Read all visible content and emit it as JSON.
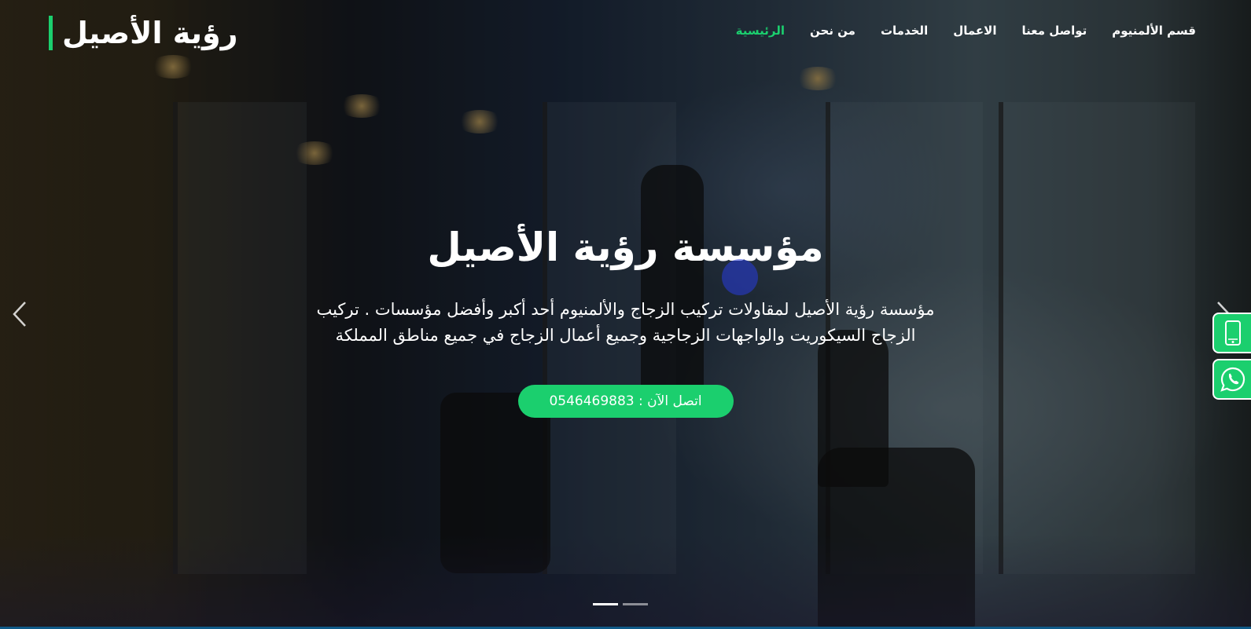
{
  "header": {
    "logo_text": "رؤية الأصيل",
    "nav": [
      {
        "label": "الرئيسية",
        "active": true
      },
      {
        "label": "من نحن",
        "active": false
      },
      {
        "label": "الخدمات",
        "active": false
      },
      {
        "label": "الاعمال",
        "active": false
      },
      {
        "label": "تواصل معنا",
        "active": false
      },
      {
        "label": "قسم الألمنيوم",
        "active": false
      }
    ]
  },
  "hero": {
    "headline": "مؤسسة رؤية الأصيل",
    "subtext": "مؤسسة رؤية الأصيل لمقاولات تركيب الزجاج والألمنيوم أحد أكبر وأفضل مؤسسات . تركيب الزجاج السيكوريت والواجهات الزجاجية وجميع أعمال الزجاج في جميع مناطق المملكة",
    "cta_label": "اتصل الآن : 0546469883"
  },
  "carousel": {
    "prev_icon": "chevron-left-icon",
    "next_icon": "chevron-right-icon",
    "slides": 2,
    "active_slide": 1
  },
  "floating": {
    "phone_icon": "mobile-phone-icon",
    "whatsapp_icon": "whatsapp-icon"
  },
  "colors": {
    "accent": "#1bcf6e"
  }
}
